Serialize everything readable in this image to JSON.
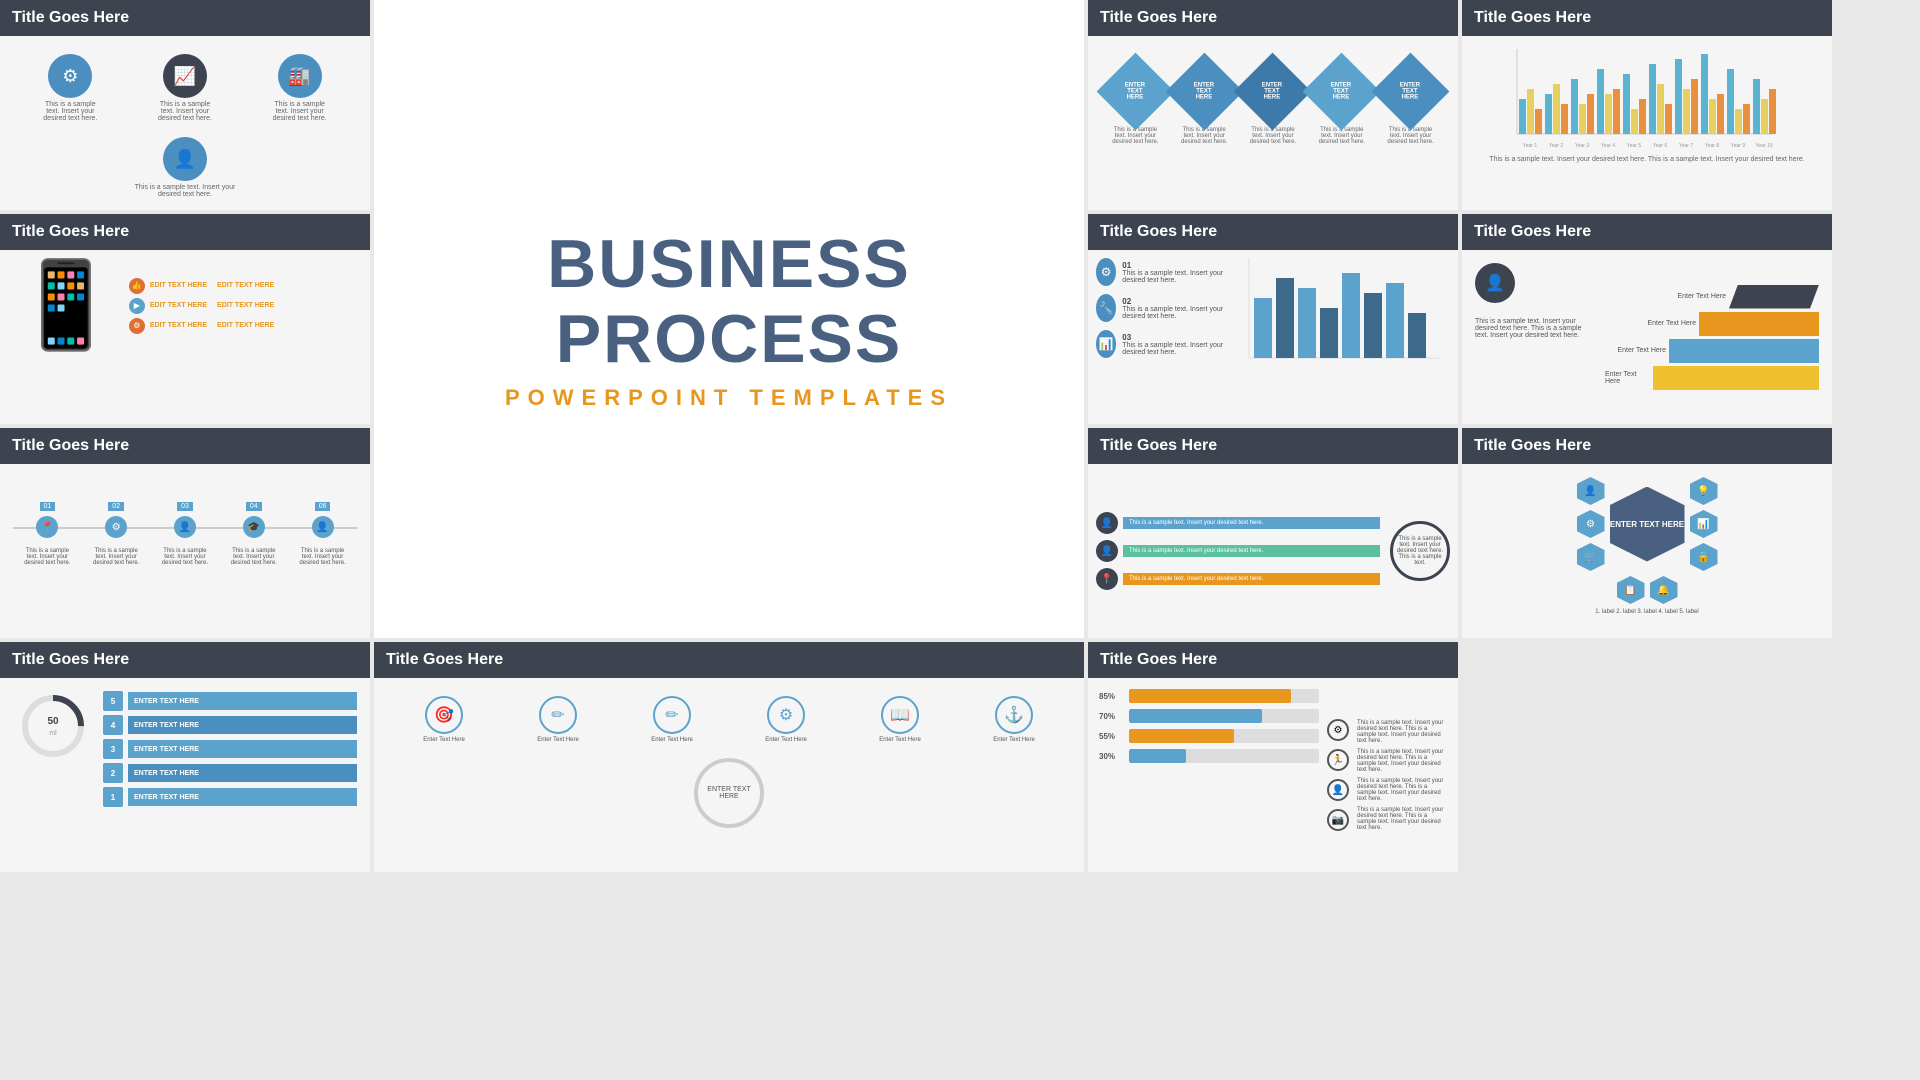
{
  "slides": [
    {
      "id": "slide1",
      "title": "Title Goes Here",
      "type": "icons",
      "icons": [
        {
          "symbol": "⚙",
          "color": "blue",
          "label": "This is a sample text. Insert your desired text here."
        },
        {
          "symbol": "📈",
          "color": "dark",
          "label": "This is a sample text. Insert your desired text here."
        },
        {
          "symbol": "🏭",
          "color": "blue",
          "label": "This is a sample text. Insert your desired text here."
        },
        {
          "symbol": "👤",
          "color": "blue",
          "label": "This is a sample text. Insert your desired text here."
        }
      ],
      "footer": "This is a sample text. Insert your desired text here."
    },
    {
      "id": "slide2",
      "title": "Title Goes Here",
      "type": "diamonds",
      "items": [
        {
          "label": "ENTER TEXT HERE"
        },
        {
          "label": "ENTER TEXT HERE"
        },
        {
          "label": "ENTER TEXT HERE"
        },
        {
          "label": "ENTER TEXT HERE"
        },
        {
          "label": "ENTER TEXT HERE"
        }
      ]
    },
    {
      "id": "slide3",
      "title": "Title Goes Here",
      "type": "bar-chart",
      "caption": "This is a sample text. Insert your desired text here. This is a sample text. Insert your desired text here."
    },
    {
      "id": "slide4",
      "title": "Title Goes Here",
      "type": "phone",
      "items": [
        "EDIT TEXT HERE",
        "EDIT TEXT HERE",
        "EDIT TEXT HERE",
        "EDIT TEXT HERE",
        "EDIT TEXT HERE",
        "EDIT TEXT HERE"
      ]
    },
    {
      "id": "center",
      "title": "BUSINESS PROCESS",
      "subtitle": "POWERPOINT TEMPLATES"
    },
    {
      "id": "slide5",
      "title": "Title Goes Here",
      "type": "list-icons",
      "items": [
        {
          "num": "01",
          "text": "This is a sample text. Insert your desired text here."
        },
        {
          "num": "02",
          "text": "This is a sample text. Insert your desired text here."
        },
        {
          "num": "03",
          "text": "This is a sample text. Insert your desired text here."
        }
      ]
    },
    {
      "id": "slide6",
      "title": "Title Goes Here",
      "type": "pyramid",
      "items": [
        {
          "text": "Enter Text Here",
          "color": "#3d4450",
          "width": 100
        },
        {
          "text": "Enter Text Here",
          "color": "#e8971e",
          "width": 130
        },
        {
          "text": "Enter Text Here",
          "color": "#5ba3cc",
          "width": 160
        },
        {
          "text": "Enter Text Here",
          "color": "#f0b429",
          "width": 190
        }
      ]
    },
    {
      "id": "slide7",
      "title": "Title Goes Here",
      "type": "timeline",
      "nodes": [
        {
          "num": "01",
          "icon": "📍"
        },
        {
          "num": "02",
          "icon": "⚙"
        },
        {
          "num": "03",
          "icon": "👤"
        },
        {
          "num": "04",
          "icon": "🎓"
        },
        {
          "num": "06",
          "icon": "👤"
        }
      ]
    },
    {
      "id": "slide8",
      "title": "Title Goes Here",
      "type": "color-bars",
      "items": [
        {
          "color": "#5ba3cc",
          "icon": "👤",
          "text": "This is a sample text. Insert your desired text here."
        },
        {
          "color": "#5bc0a0",
          "icon": "👤",
          "text": "This is a sample text. Insert your desired text here."
        },
        {
          "color": "#e8971e",
          "icon": "📍",
          "text": "This is a sample text. Insert your desired text here."
        }
      ],
      "circleText": "This is a sample text. Insert your desired text here. This is a sample text."
    },
    {
      "id": "slide9",
      "title": "Title Goes Here",
      "type": "hex-cluster",
      "centerText": "ENTER TEXT HERE"
    },
    {
      "id": "slide10",
      "title": "Title Goes Here",
      "type": "gauge",
      "value": "50",
      "unit": "ml",
      "steps": [
        {
          "num": 5,
          "label": "ENTER TEXT HERE"
        },
        {
          "num": 4,
          "label": "ENTER TEXT HERE"
        },
        {
          "num": 3,
          "label": "ENTER TEXT HERE"
        },
        {
          "num": 2,
          "label": "ENTER TEXT HERE"
        },
        {
          "num": 1,
          "label": "ENTER TEXT HERE"
        }
      ]
    },
    {
      "id": "slide11",
      "title": "Title Goes Here",
      "type": "icon-row",
      "icons": [
        "🎯",
        "✏",
        "✏",
        "⚙",
        "📖",
        "⚓"
      ],
      "labels": [
        "Enter Text Here",
        "Enter Text Here",
        "Enter Text Here",
        "Enter Text Here",
        "Enter Text Here",
        "Enter Text Here"
      ],
      "centerText": "ENTER TEXT HERE"
    },
    {
      "id": "slide12",
      "title": "Title Goes Here",
      "type": "progress",
      "bars": [
        {
          "label": "85%",
          "pct": 85,
          "color": "#e8971e"
        },
        {
          "label": "70%",
          "pct": 70,
          "color": "#5ba3cc"
        },
        {
          "label": "55%",
          "pct": 55,
          "color": "#e8971e"
        },
        {
          "label": "30%",
          "pct": 30,
          "color": "#5ba3cc"
        }
      ],
      "icons": [
        "⚙",
        "🏃",
        "👤",
        "📷"
      ]
    }
  ]
}
